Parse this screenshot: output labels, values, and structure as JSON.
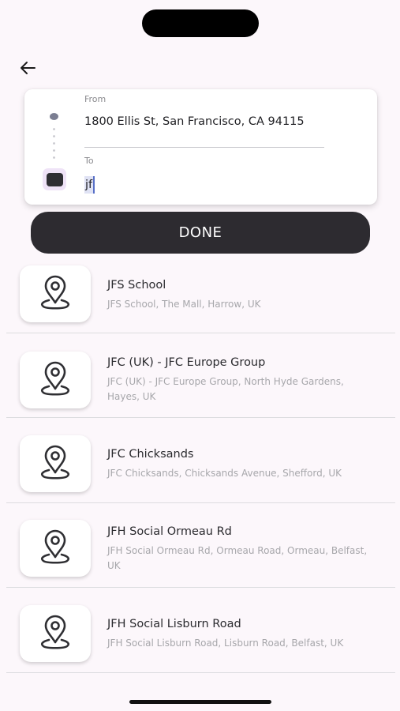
{
  "route": {
    "from_label": "From",
    "from_value": "1800 Ellis St, San Francisco, CA 94115",
    "to_label": "To",
    "to_value": "jf"
  },
  "done_label": "DONE",
  "results": [
    {
      "title": "JFS School",
      "subtitle": "JFS School, The Mall, Harrow, UK"
    },
    {
      "title": "JFC (UK) - JFC Europe Group",
      "subtitle": "JFC (UK) - JFC Europe Group, North Hyde Gardens, Hayes, UK"
    },
    {
      "title": "JFC Chicksands",
      "subtitle": "JFC Chicksands, Chicksands Avenue, Shefford, UK"
    },
    {
      "title": "JFH Social Ormeau Rd",
      "subtitle": "JFH Social Ormeau Rd, Ormeau Road, Ormeau, Belfast, UK"
    },
    {
      "title": "JFH Social Lisburn Road",
      "subtitle": "JFH Social Lisburn Road, Lisburn Road, Belfast, UK"
    }
  ],
  "icons": {
    "back": "back-arrow-icon",
    "result": "location-pin-icon"
  }
}
